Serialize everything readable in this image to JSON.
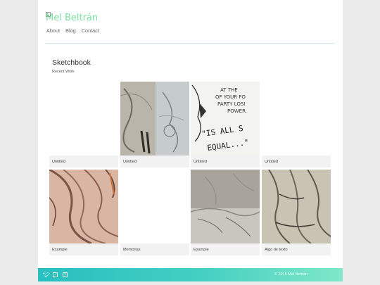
{
  "site": {
    "title": "Mel Beltrán"
  },
  "nav": {
    "items": [
      "About",
      "Blog",
      "Contact"
    ]
  },
  "section": {
    "title": "Sketchbook",
    "subtitle": "Recent Work"
  },
  "gallery": [
    {
      "caption": "Untitled"
    },
    {
      "caption": "Untitled"
    },
    {
      "caption": "Untitled"
    },
    {
      "caption": "Untitled"
    },
    {
      "caption": "Example"
    },
    {
      "caption": "Memorias"
    },
    {
      "caption": "Example"
    },
    {
      "caption": "Algo de texto"
    }
  ],
  "sketch_text": {
    "line1": "AT THE",
    "line2": "OF YOUR FO",
    "line3": "PARTY LOSI",
    "line4": "POWER.",
    "big1": "\"IS ALL S",
    "big2": "EQUAL...\""
  },
  "footer": {
    "copyright": "© 2015 Mel Beltrán",
    "icons": [
      "twitter-icon",
      "instagram-icon",
      "tumblr-icon"
    ]
  },
  "colors": {
    "accent": "#7ee0a0",
    "footer_start": "#27bfc0",
    "footer_end": "#7fe8c8"
  }
}
